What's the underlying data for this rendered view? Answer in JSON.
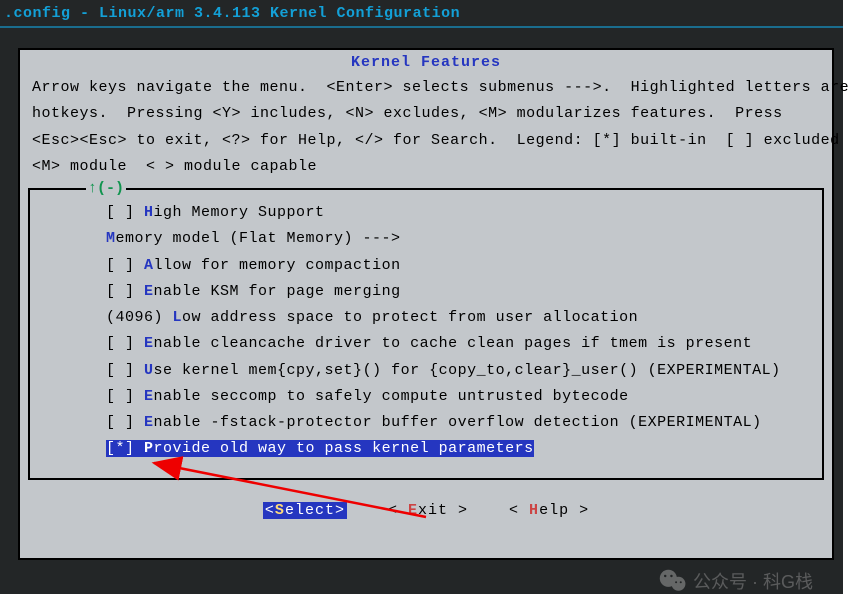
{
  "window_title": ".config - Linux/arm 3.4.113 Kernel Configuration",
  "section_title": "Kernel Features",
  "help_lines": [
    "Arrow keys navigate the menu.  <Enter> selects submenus --->.  Highlighted letters are",
    "hotkeys.  Pressing <Y> includes, <N> excludes, <M> modularizes features.  Press",
    "<Esc><Esc> to exit, <?> for Help, </> for Search.  Legend: [*] built-in  [ ] excluded",
    "<M> module  < > module capable"
  ],
  "scroll_indicator": "↑(-)",
  "menu": {
    "items": [
      {
        "prefix": "[ ] ",
        "hot": "H",
        "rest": "igh Memory Support",
        "sub": false
      },
      {
        "prefix": "    ",
        "hot": "M",
        "rest": "emory model (Flat Memory)  --->",
        "sub": true
      },
      {
        "prefix": "[ ] ",
        "hot": "A",
        "rest": "llow for memory compaction"
      },
      {
        "prefix": "[ ] ",
        "hot": "E",
        "rest": "nable KSM for page merging"
      },
      {
        "prefix": "(4096) ",
        "hot": "L",
        "rest": "ow address space to protect from user allocation",
        "numeric": true
      },
      {
        "prefix": "[ ] ",
        "hot": "E",
        "rest": "nable cleancache driver to cache clean pages if tmem is present"
      },
      {
        "prefix": "[ ] ",
        "hot": "U",
        "rest": "se kernel mem{cpy,set}() for {copy_to,clear}_user() (EXPERIMENTAL)"
      },
      {
        "prefix": "[ ] ",
        "hot": "E",
        "rest": "nable seccomp to safely compute untrusted bytecode"
      },
      {
        "prefix": "[ ] ",
        "hot": "E",
        "rest": "nable -fstack-protector buffer overflow detection (EXPERIMENTAL)"
      },
      {
        "prefix": "[*] ",
        "hot": "P",
        "rest": "rovide old way to pass kernel parameters",
        "selected": true
      }
    ]
  },
  "buttons": {
    "select": {
      "open": "<",
      "hot": "S",
      "rest": "elect>",
      "active": true
    },
    "exit": {
      "open": "< ",
      "hot": "E",
      "rest": "xit >"
    },
    "help": {
      "open": "< ",
      "hot": "H",
      "rest": "elp >"
    }
  },
  "watermark": "公众号 · 科G栈"
}
